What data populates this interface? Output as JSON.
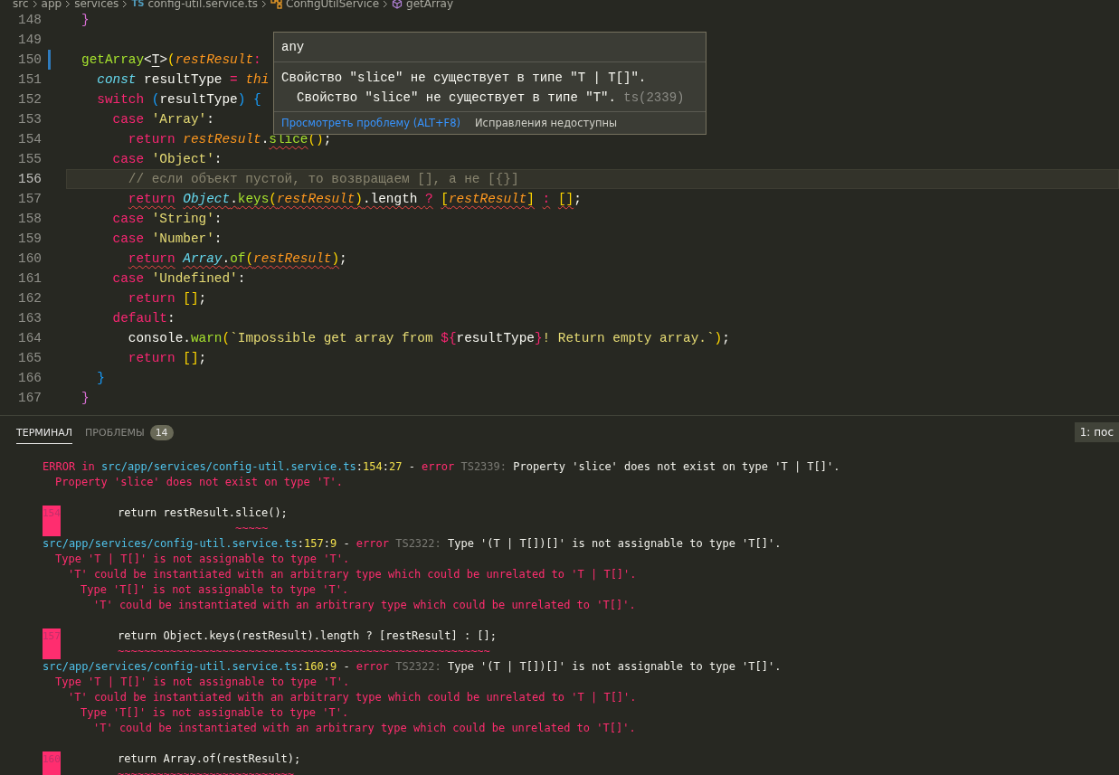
{
  "breadcrumbs": [
    {
      "text": "src",
      "kind": "folder"
    },
    {
      "text": "app",
      "kind": "folder"
    },
    {
      "text": "services",
      "kind": "folder"
    },
    {
      "text": "config-util.service.ts",
      "kind": "ts-file",
      "badge": "TS"
    },
    {
      "text": "ConfigUtilService",
      "kind": "class"
    },
    {
      "text": "getArray",
      "kind": "method"
    }
  ],
  "editor": {
    "lines": [
      {
        "number": "148",
        "current": false,
        "modified": false,
        "tokens": [
          {
            "text": "}",
            "kind": "bracket2"
          }
        ]
      },
      {
        "number": "149",
        "current": false,
        "modified": false
      },
      {
        "number": "150",
        "current": false,
        "modified": true,
        "tokens": [
          {
            "text": "getArray",
            "kind": "func"
          },
          {
            "text": "<",
            "kind": "plain"
          },
          {
            "text": "T",
            "kind": "type"
          },
          {
            "text": ">",
            "kind": "plain"
          },
          {
            "text": "(",
            "kind": "bracket1"
          },
          {
            "text": "restResult",
            "kind": "param"
          },
          {
            "text": ":",
            "kind": "op"
          }
        ]
      },
      {
        "number": "151",
        "current": false,
        "modified": false,
        "tokens": [
          {
            "text": "  const",
            "kind": "storage"
          },
          {
            "text": " resultType ",
            "kind": "plain"
          },
          {
            "text": "=",
            "kind": "op"
          },
          {
            "text": " thi",
            "kind": "this"
          }
        ]
      },
      {
        "number": "152",
        "current": false,
        "modified": false,
        "tokens": [
          {
            "text": "  switch",
            "kind": "keyword"
          },
          {
            "text": " (",
            "kind": "bracket3"
          },
          {
            "text": "resultType",
            "kind": "plain"
          },
          {
            "text": ")",
            "kind": "bracket3"
          },
          {
            "text": " {",
            "kind": "bracket3"
          }
        ]
      },
      {
        "number": "153",
        "current": false,
        "modified": false,
        "tokens": [
          {
            "text": "    case",
            "kind": "keyword"
          },
          {
            "text": " 'Array'",
            "kind": "string"
          },
          {
            "text": ":",
            "kind": "plain"
          }
        ]
      },
      {
        "number": "154",
        "current": false,
        "modified": false,
        "tokens": [
          {
            "text": "      return",
            "kind": "keyword"
          },
          {
            "text": " restResult",
            "kind": "param"
          },
          {
            "text": ".",
            "kind": "plain"
          },
          {
            "text": "slice",
            "kind": "func",
            "squiggle": true
          },
          {
            "text": "()",
            "kind": "bracket1"
          },
          {
            "text": ";",
            "kind": "plain"
          }
        ]
      },
      {
        "number": "155",
        "current": false,
        "modified": false,
        "tokens": [
          {
            "text": "    case",
            "kind": "keyword"
          },
          {
            "text": " 'Object'",
            "kind": "string"
          },
          {
            "text": ":",
            "kind": "plain"
          }
        ]
      },
      {
        "number": "156",
        "current": true,
        "modified": false,
        "tokens": [
          {
            "text": "      // если объект пустой, то возвращаем [], а не [{}]",
            "kind": "comment"
          }
        ]
      },
      {
        "number": "157",
        "current": false,
        "modified": false,
        "tokens": [
          {
            "text": "      return",
            "kind": "keyword",
            "squiggle": true
          },
          {
            "text": " Object",
            "kind": "class",
            "squiggle": true
          },
          {
            "text": ".",
            "kind": "plain",
            "squiggle": true
          },
          {
            "text": "keys",
            "kind": "func",
            "squiggle": true
          },
          {
            "text": "(",
            "kind": "bracket1",
            "squiggle": true
          },
          {
            "text": "restResult",
            "kind": "param",
            "squiggle": true
          },
          {
            "text": ")",
            "kind": "bracket1",
            "squiggle": true
          },
          {
            "text": ".length ",
            "kind": "plain",
            "squiggle": true
          },
          {
            "text": "?",
            "kind": "op",
            "squiggle": true
          },
          {
            "text": " [",
            "kind": "bracket1",
            "squiggle": true
          },
          {
            "text": "restResult",
            "kind": "param",
            "squiggle": true
          },
          {
            "text": "]",
            "kind": "bracket1",
            "squiggle": true
          },
          {
            "text": " :",
            "kind": "op",
            "squiggle": true
          },
          {
            "text": " []",
            "kind": "bracket1",
            "squiggle": true
          },
          {
            "text": ";",
            "kind": "plain"
          }
        ]
      },
      {
        "number": "158",
        "current": false,
        "modified": false,
        "tokens": [
          {
            "text": "    case",
            "kind": "keyword"
          },
          {
            "text": " 'String'",
            "kind": "string"
          },
          {
            "text": ":",
            "kind": "plain"
          }
        ]
      },
      {
        "number": "159",
        "current": false,
        "modified": false,
        "tokens": [
          {
            "text": "    case",
            "kind": "keyword"
          },
          {
            "text": " 'Number'",
            "kind": "string"
          },
          {
            "text": ":",
            "kind": "plain"
          }
        ]
      },
      {
        "number": "160",
        "current": false,
        "modified": false,
        "tokens": [
          {
            "text": "      return",
            "kind": "keyword",
            "squiggle": true
          },
          {
            "text": " Array",
            "kind": "class",
            "squiggle": true
          },
          {
            "text": ".",
            "kind": "plain",
            "squiggle": true
          },
          {
            "text": "of",
            "kind": "func",
            "squiggle": true
          },
          {
            "text": "(",
            "kind": "bracket1",
            "squiggle": true
          },
          {
            "text": "restResult",
            "kind": "param",
            "squiggle": true
          },
          {
            "text": ")",
            "kind": "bracket1",
            "squiggle": true
          },
          {
            "text": ";",
            "kind": "plain"
          }
        ]
      },
      {
        "number": "161",
        "current": false,
        "modified": false,
        "tokens": [
          {
            "text": "    case",
            "kind": "keyword"
          },
          {
            "text": " 'Undefined'",
            "kind": "string"
          },
          {
            "text": ":",
            "kind": "plain"
          }
        ]
      },
      {
        "number": "162",
        "current": false,
        "modified": false,
        "tokens": [
          {
            "text": "      return",
            "kind": "keyword"
          },
          {
            "text": " []",
            "kind": "bracket1"
          },
          {
            "text": ";",
            "kind": "plain"
          }
        ]
      },
      {
        "number": "163",
        "current": false,
        "modified": false,
        "tokens": [
          {
            "text": "    default",
            "kind": "keyword"
          },
          {
            "text": ":",
            "kind": "plain"
          }
        ]
      },
      {
        "number": "164",
        "current": false,
        "modified": false,
        "tokens": [
          {
            "text": "      console.",
            "kind": "plain"
          },
          {
            "text": "warn",
            "kind": "func"
          },
          {
            "text": "(",
            "kind": "bracket1"
          },
          {
            "text": "`Impossible get array from ",
            "kind": "string"
          },
          {
            "text": "${",
            "kind": "op"
          },
          {
            "text": "resultType",
            "kind": "plain"
          },
          {
            "text": "}",
            "kind": "op"
          },
          {
            "text": "! Return empty array.`",
            "kind": "string"
          },
          {
            "text": ")",
            "kind": "bracket1"
          },
          {
            "text": ";",
            "kind": "plain"
          }
        ]
      },
      {
        "number": "165",
        "current": false,
        "modified": false,
        "tokens": [
          {
            "text": "      return",
            "kind": "keyword"
          },
          {
            "text": " []",
            "kind": "bracket1"
          },
          {
            "text": ";",
            "kind": "plain"
          }
        ]
      },
      {
        "number": "166",
        "current": false,
        "modified": false,
        "tokens": [
          {
            "text": "  }",
            "kind": "bracket3"
          }
        ]
      },
      {
        "number": "167",
        "current": false,
        "modified": false,
        "tokens": [
          {
            "text": "}",
            "kind": "bracket2"
          }
        ]
      }
    ]
  },
  "hover": {
    "type": "any",
    "message": {
      "text": "Свойство \"slice\" не существует в типе \"T | T[]\".",
      "children": [
        {
          "text": "Свойство \"slice\" не существует в типе \"T\".",
          "code": "ts(2339)"
        }
      ]
    },
    "link": "Просмотреть проблему (ALT+F8)",
    "note": "Исправления недоступны"
  },
  "panel": {
    "tabs": [
      {
        "label": "ТЕРМИНАЛ",
        "selected": true
      },
      {
        "label": "ПРОБЛЕМЫ",
        "selected": false,
        "count": "14"
      }
    ],
    "terminal_select": "1: пос",
    "errors": [
      {
        "header": [
          {
            "text": "ERROR in ",
            "kind": "error"
          },
          {
            "text": "src/app/services/config-util.service.ts",
            "kind": "path"
          },
          {
            "text": ":",
            "kind": "plain"
          },
          {
            "text": "154",
            "kind": "loc"
          },
          {
            "text": ":",
            "kind": "plain"
          },
          {
            "text": "27",
            "kind": "loc"
          },
          {
            "text": " - ",
            "kind": "plain"
          },
          {
            "text": "error",
            "kind": "error"
          },
          {
            "text": " TS2339:",
            "kind": "dim"
          },
          {
            "text": " Property 'slice' does not exist on type 'T | T[]'.",
            "kind": "plain"
          }
        ],
        "details": [
          {
            "text": "Property 'slice' does not exist on type 'T'."
          }
        ],
        "snippet": {
          "number": "154",
          "before": "return restResult.",
          "marked": "slice",
          "after": "();",
          "underline": "~~~~~"
        }
      },
      {
        "header": [
          {
            "text": "src/app/services/config-util.service.ts",
            "kind": "path"
          },
          {
            "text": ":",
            "kind": "plain"
          },
          {
            "text": "157",
            "kind": "loc"
          },
          {
            "text": ":",
            "kind": "plain"
          },
          {
            "text": "9",
            "kind": "loc"
          },
          {
            "text": " - ",
            "kind": "plain"
          },
          {
            "text": "error",
            "kind": "error"
          },
          {
            "text": " TS2322:",
            "kind": "dim"
          },
          {
            "text": " Type '(T | T[])[]' is not assignable to type 'T[]'.",
            "kind": "plain"
          }
        ],
        "details": [
          {
            "text": "Type 'T | T[]' is not assignable to type 'T'.",
            "children": [
              {
                "text": "'T' could be instantiated with an arbitrary type which could be unrelated to 'T | T[]'.",
                "children": [
                  {
                    "text": "Type 'T[]' is not assignable to type 'T'.",
                    "children": [
                      {
                        "text": "'T' could be instantiated with an arbitrary type which could be unrelated to 'T[]'."
                      }
                    ]
                  }
                ]
              }
            ]
          }
        ],
        "snippet": {
          "number": "157",
          "marked": "return Object.keys(restResult).length ? [restResult] : [];",
          "underline": "~~~~~~~~~~~~~~~~~~~~~~~~~~~~~~~~~~~~~~~~~~~~~~~~~~~~~~~~~"
        }
      },
      {
        "header": [
          {
            "text": "src/app/services/config-util.service.ts",
            "kind": "path"
          },
          {
            "text": ":",
            "kind": "plain"
          },
          {
            "text": "160",
            "kind": "loc"
          },
          {
            "text": ":",
            "kind": "plain"
          },
          {
            "text": "9",
            "kind": "loc"
          },
          {
            "text": " - ",
            "kind": "plain"
          },
          {
            "text": "error",
            "kind": "error"
          },
          {
            "text": " TS2322:",
            "kind": "dim"
          },
          {
            "text": " Type '(T | T[])[]' is not assignable to type 'T[]'.",
            "kind": "plain"
          }
        ],
        "details": [
          {
            "text": "Type 'T | T[]' is not assignable to type 'T'.",
            "children": [
              {
                "text": "'T' could be instantiated with an arbitrary type which could be unrelated to 'T | T[]'.",
                "children": [
                  {
                    "text": "Type 'T[]' is not assignable to type 'T'.",
                    "children": [
                      {
                        "text": "'T' could be instantiated with an arbitrary type which could be unrelated to 'T[]'."
                      }
                    ]
                  }
                ]
              }
            ]
          }
        ],
        "snippet": {
          "number": "160",
          "marked": "return Array.of(restResult);",
          "underline": "~~~~~~~~~~~~~~~~~~~~~~~~~~~"
        }
      }
    ]
  }
}
